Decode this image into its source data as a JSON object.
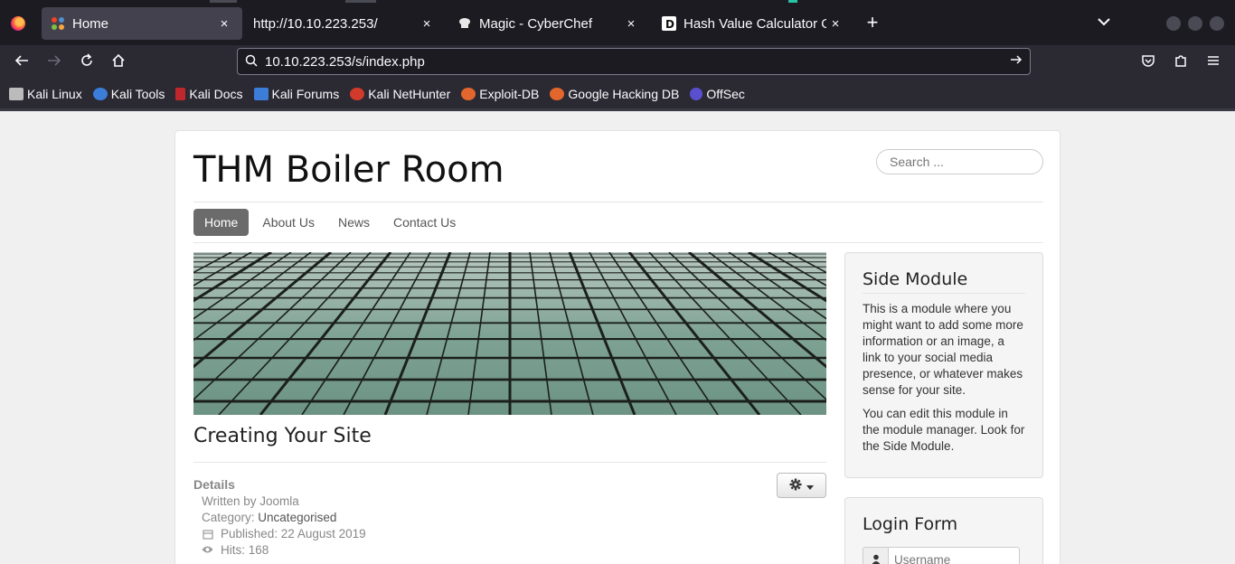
{
  "browser": {
    "tabs": [
      {
        "title": "Home",
        "active": true,
        "favicon": "joomla-icon"
      },
      {
        "title": "http://10.10.223.253/",
        "active": false,
        "favicon": "none"
      },
      {
        "title": "Magic - CyberChef",
        "active": false,
        "favicon": "cyberchef-icon"
      },
      {
        "title": "Hash Value Calculator Onl",
        "active": false,
        "favicon": "hash-calculator-icon"
      }
    ],
    "close_glyph": "×",
    "new_tab_glyph": "+",
    "address": "10.10.223.253/s/index.php",
    "bookmarks": [
      "Kali Linux",
      "Kali Tools",
      "Kali Docs",
      "Kali Forums",
      "Kali NetHunter",
      "Exploit-DB",
      "Google Hacking DB",
      "OffSec"
    ],
    "bookmark_colors": [
      "#bbbbbb",
      "#3b7dd8",
      "#c0272d",
      "#3b7dd8",
      "#d23a2c",
      "#e3672d",
      "#e3672d",
      "#5a4fcf"
    ]
  },
  "site": {
    "title": "THM Boiler Room",
    "search_placeholder": "Search ...",
    "menu": [
      "Home",
      "About Us",
      "News",
      "Contact Us"
    ],
    "article": {
      "title": "Creating Your Site",
      "details_label": "Details",
      "written_by": "Written by Joomla",
      "category_label": "Category:",
      "category": "Uncategorised",
      "published": "Published: 22 August 2019",
      "hits": "Hits: 168"
    },
    "side_module": {
      "title": "Side Module",
      "p1": "This is a module where you might want to add some more information or an image, a link to your social media presence, or whatever makes sense for your site.",
      "p2": "You can edit this module in the module manager. Look for the Side Module."
    },
    "login": {
      "title": "Login Form",
      "username_placeholder": "Username"
    }
  }
}
